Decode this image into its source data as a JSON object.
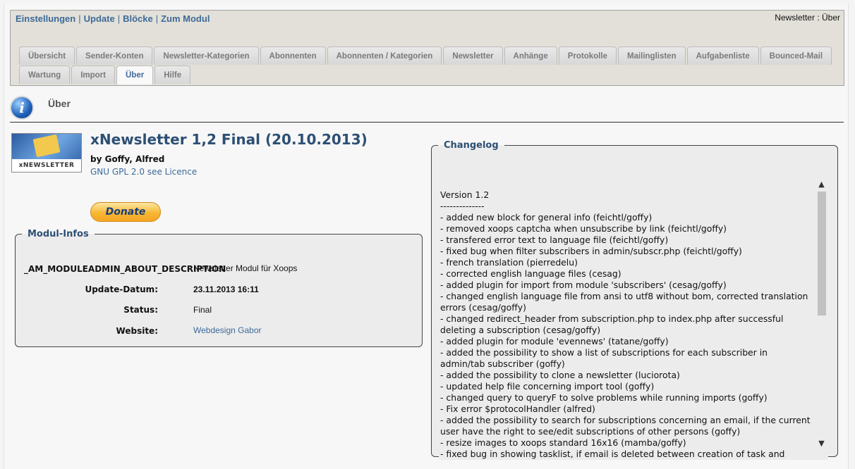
{
  "top_nav": {
    "links": [
      "Einstellungen",
      "Update",
      "Blöcke",
      "Zum Modul"
    ],
    "separator": "|"
  },
  "breadcrumb": "Newsletter : Über",
  "tabs_row1": [
    "Übersicht",
    "Sender-Konten",
    "Newsletter-Kategorien",
    "Abonnenten",
    "Abonnenten / Kategorien",
    "Newsletter",
    "Anhänge",
    "Protokolle",
    "Mailinglisten",
    "Aufgabenliste",
    "Bounced-Mail"
  ],
  "tabs_row2": [
    "Wartung",
    "Import",
    "Über",
    "Hilfe"
  ],
  "active_tab": "Über",
  "page_title": "Über",
  "module": {
    "logo_text": "xNEWSLETTER",
    "name": "xNewsletter 1,2 Final (20.10.2013)",
    "author": "by Goffy, Alfred",
    "license": "GNU GPL 2.0 see Licence",
    "donate_label": "Donate"
  },
  "modinfo": {
    "legend": "Modul-Infos",
    "rows": [
      {
        "label": "_AM_MODULEADMIN_ABOUT_DESCRIPTION",
        "value": "Newsletter Modul für Xoops"
      },
      {
        "label": "Update-Datum:",
        "value": "23.11.2013 16:11"
      },
      {
        "label": "Status:",
        "value": "Final"
      },
      {
        "label": "Website:",
        "value": "Webdesign Gabor"
      }
    ]
  },
  "changelog": {
    "legend": "Changelog",
    "text": "Version 1.2\n--------------\n- added new block for general info (feichtl/goffy)\n- removed xoops captcha when unsubscribe by link (feichtl/goffy)\n- transfered error text to language file (feichtl/goffy)\n- fixed bug when filter subscribers in admin/subscr.php (feichtl/goffy)\n- french translation (pierredelu)\n- corrected english language files (cesag)\n- added plugin for import from module 'subscribers' (cesag/goffy)\n- changed english language file from ansi to utf8 without bom, corrected translation errors (cesag/goffy)\n- changed redirect_header from subscription.php to index.php after successful deleting a subscription (cesag/goffy)\n- added plugin for module 'evennews' (tatane/goffy)\n- added the possibility to show a list of subscriptions for each subscriber in admin/tab subscriber (goffy)\n- added the possibility to clone a newsletter (luciorota)\n- updated help file concerning import tool (goffy)\n- changed query to queryF to solve problems while running imports (goffy)\n- Fix error $protocolHandler (alfred)\n- added the possibility to search for subscriptions concerning an email, if the current user have the right to see/edit subscriptions of other persons (goffy)\n- resize images to xoops standard 16x16 (mamba/goffy)\n- fixed bug in showing tasklist, if email is deleted between creation of task and"
  },
  "colors": {
    "link": "#3d6a99",
    "title": "#2d4f73",
    "header_bg": "#e2e0d8"
  }
}
